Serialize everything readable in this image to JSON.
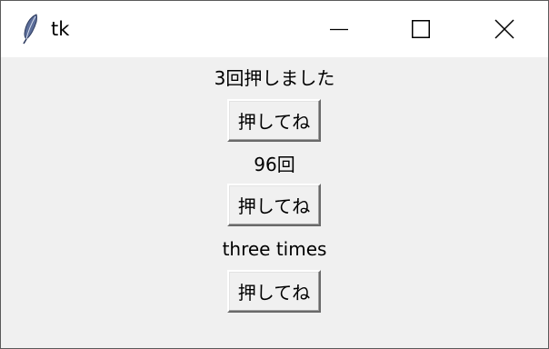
{
  "window": {
    "title": "tk",
    "icon": "feather-icon",
    "controls": [
      "minimize-icon",
      "maximize-icon",
      "close-icon"
    ]
  },
  "rows": [
    {
      "label": "3回押しました",
      "button": "押してね"
    },
    {
      "label": "96回",
      "button": "押してね"
    },
    {
      "label": "three times",
      "button": "押してね"
    }
  ]
}
